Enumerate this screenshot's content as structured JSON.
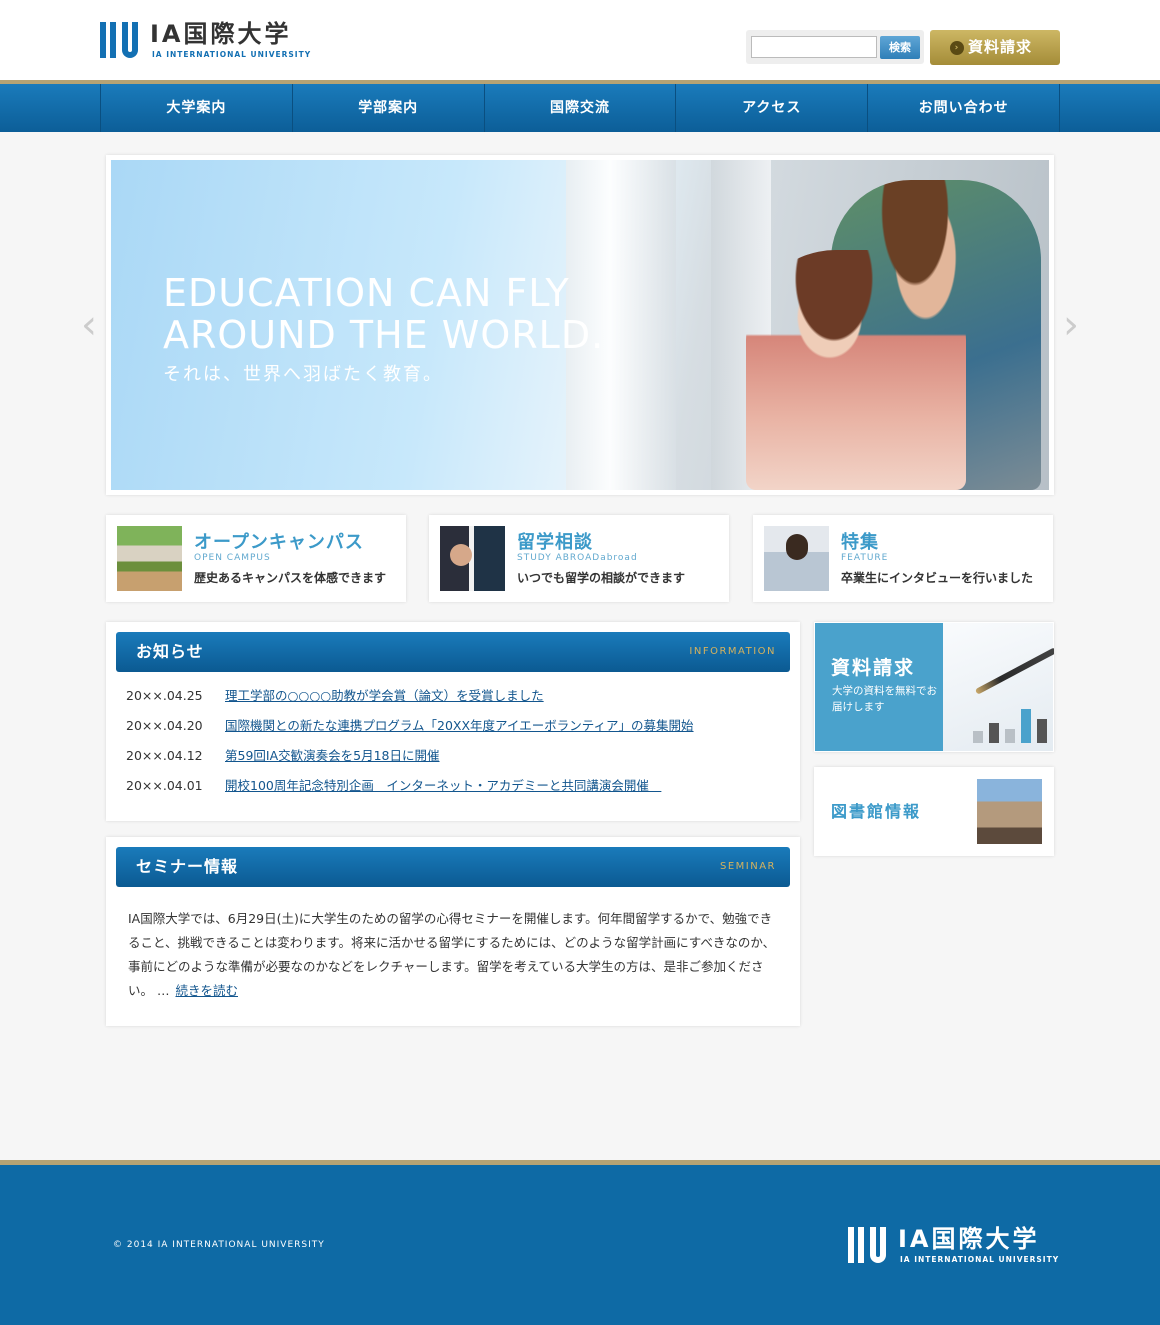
{
  "header": {
    "logo_text": "IA国際大学",
    "logo_sub": "IA INTERNATIONAL UNIVERSITY",
    "search_button": "検索",
    "search_value": "",
    "request_button": "資料請求"
  },
  "nav": {
    "items": [
      {
        "label": "大学案内"
      },
      {
        "label": "学部案内"
      },
      {
        "label": "国際交流"
      },
      {
        "label": "アクセス"
      },
      {
        "label": "お問い合わせ"
      }
    ]
  },
  "hero": {
    "line1": "EDUCATION CAN FLY",
    "line2": "AROUND THE WORLD.",
    "sub": "それは、世界へ羽ばたく教育。",
    "prev_icon": "‹",
    "next_icon": "›"
  },
  "cards": [
    {
      "title": "オープンキャンパス",
      "en": "OPEN CAMPUS",
      "desc": "歴史あるキャンパスを体感できます"
    },
    {
      "title": "留学相談",
      "en": "STUDY ABROADabroad",
      "desc": "いつでも留学の相談ができます"
    },
    {
      "title": "特集",
      "en": "FEATURE",
      "desc": "卒業生にインタビューを行いました"
    }
  ],
  "news": {
    "title": "お知らせ",
    "en": "INFORMATION",
    "items": [
      {
        "date": "20××.04.25",
        "text": "理工学部の○○○○助教が学会賞（論文）を受賞しました"
      },
      {
        "date": "20××.04.20",
        "text": "国際機関との新たな連携プログラム「20XX年度アイエーボランティア」の募集開始"
      },
      {
        "date": "20××.04.12",
        "text": "第59回IA交歓演奏会を5月18日に開催"
      },
      {
        "date": "20××.04.01",
        "text": "開校100周年記念特別企画　インターネット・アカデミーと共同講演会開催　"
      }
    ]
  },
  "seminar": {
    "title": "セミナー情報",
    "en": "SEMINAR",
    "body": "IA国際大学では、6月29日(土)に大学生のための留学の心得セミナーを開催します。何年間留学するかで、勉強できること、挑戦できることは変わります。将来に活かせる留学にするためには、どのような留学計画にすべきなのか、事前にどのような準備が必要なのかなどをレクチャーします。留学を考えている大学生の方は、是非ご参加ください。 …",
    "more": "続きを読む"
  },
  "sidebar": {
    "request_title": "資料請求",
    "request_sub": "大学の資料を無料でお届けします",
    "library_title": "図書館情報"
  },
  "footer": {
    "copyright": "© 2014 IA INTERNATIONAL UNIVERSITY",
    "logo_text": "IA国際大学",
    "logo_sub": "IA INTERNATIONAL UNIVERSITY"
  },
  "colors": {
    "primary_blue": "#1370b3",
    "gold": "#b5a374",
    "light_blue": "#4aa2cc"
  }
}
